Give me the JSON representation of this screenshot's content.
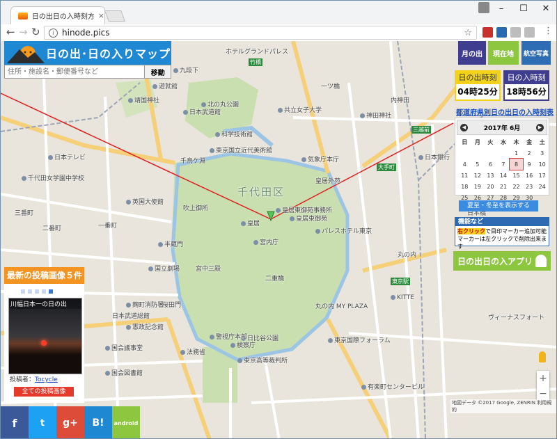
{
  "browser": {
    "tab_title": "日の出日の入時刻方角マ",
    "url": "hinode.pics"
  },
  "header": {
    "app_title": "日の出･日の入りマップ",
    "search_placeholder": "住所・施設名・郵便番号など",
    "search_button": "移動"
  },
  "right_panel": {
    "top_buttons": [
      "月の出",
      "現在地",
      "航空写真"
    ],
    "top_colors": [
      "#3f3d8f",
      "#8dc63f",
      "#2e6db4"
    ],
    "sunrise": {
      "label": "日の出時刻",
      "time": "04時25分"
    },
    "sunset": {
      "label": "日の入時刻",
      "time": "18時56分"
    },
    "pref_link": "都道府県別日の出日の入時刻表",
    "calendar": {
      "year": "2017年",
      "month": "6月",
      "weekdays": [
        "日",
        "月",
        "火",
        "水",
        "木",
        "金",
        "土"
      ],
      "weeks": [
        [
          "",
          "",
          "",
          "",
          "1",
          "2",
          "3"
        ],
        [
          "4",
          "5",
          "6",
          "7",
          "8",
          "9",
          "10"
        ],
        [
          "11",
          "12",
          "13",
          "14",
          "15",
          "16",
          "17"
        ],
        [
          "18",
          "19",
          "20",
          "21",
          "22",
          "23",
          "24"
        ],
        [
          "25",
          "26",
          "27",
          "28",
          "29",
          "30",
          ""
        ]
      ],
      "selected": "8"
    },
    "solstice_button": "夏至・冬至を表示する",
    "features": {
      "heading": "機能など",
      "highlight": "右クリック",
      "text1": "で目印マーカー追加可能",
      "text2": "マーカーは左クリックで削除出来ます"
    },
    "app_button": "日の出日の入アプリ"
  },
  "posts": {
    "heading": "最新の投稿画像５件",
    "image_caption": "川幅日本一の日の出",
    "poster_label": "投稿者：",
    "poster_name": "Tocycle",
    "all_button": "全ての投稿画像"
  },
  "social": {
    "buttons": [
      "f",
      "t",
      "g+",
      "B!",
      "android"
    ],
    "colors": [
      "#3b5998",
      "#1da1f2",
      "#dd4b39",
      "#1e88d2",
      "#8dc63f"
    ]
  },
  "map": {
    "labels": [
      "ホテルグランドパレス",
      "竹橋",
      "九段下",
      "北の丸公園",
      "遊就館",
      "靖国神社",
      "日本武道館",
      "科学技術館",
      "共立女子大学",
      "一ツ橋",
      "千代田区",
      "東京国立近代美術館",
      "気象庁本庁",
      "大手町",
      "皇居外苑",
      "皇居",
      "皇居東御苑",
      "宮内庁",
      "千鳥ケ淵",
      "半蔵門",
      "国立劇場",
      "英国大使館",
      "吹上御所",
      "宮中三殿",
      "東京駅",
      "丸の内",
      "丸の内 MY PLAZA",
      "KITTE",
      "東京国際フォーラム",
      "有楽町センタービル",
      "日比谷公園",
      "国会議事堂",
      "日本武道総館",
      "二重橋",
      "桜田門",
      "警視庁本部",
      "法務省",
      "検察庁",
      "東京高等裁判所",
      "パレスホテル東京",
      "皇居東御苑事務所",
      "日本テレビ",
      "三番町",
      "二番町",
      "一番町",
      "千代田女学園中学校",
      "麹町消防署",
      "憲政記念館",
      "国会図書館",
      "神田神社",
      "内神田",
      "日本銀行",
      "三越前",
      "日本橋",
      "ヴィーナスフォート"
    ],
    "attribution": "地図データ ©2017 Google, ZENRIN",
    "terms": "利用規約"
  }
}
